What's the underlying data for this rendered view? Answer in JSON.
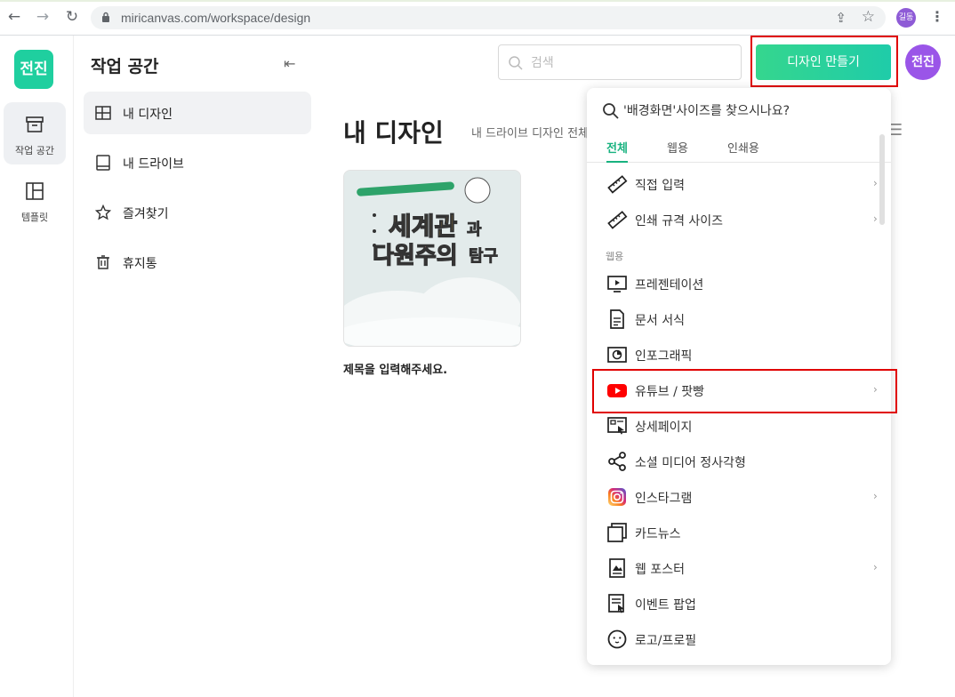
{
  "browser": {
    "url": "miricanvas.com/workspace/design",
    "profile_label": "길동"
  },
  "rail": {
    "logo": "전진",
    "items": [
      {
        "label": "작업 공간",
        "icon": "archive-icon"
      },
      {
        "label": "템플릿",
        "icon": "template-icon"
      }
    ]
  },
  "panel": {
    "title": "작업 공간",
    "nav": [
      {
        "label": "내 디자인",
        "icon": "grid-icon"
      },
      {
        "label": "내 드라이브",
        "icon": "drive-icon"
      },
      {
        "label": "즐겨찾기",
        "icon": "star-icon"
      },
      {
        "label": "휴지통",
        "icon": "trash-icon"
      }
    ]
  },
  "header": {
    "search_placeholder": "검색",
    "create_label": "디자인 만들기",
    "avatar": "전진"
  },
  "main": {
    "title": "내 디자인",
    "subtitle": "내 드라이브 디자인 전체",
    "card": {
      "caption": "제목을 입력해주세요.",
      "art_line1": "세계관",
      "art_line1b": "과",
      "art_line2": "다원주의",
      "art_line2b": "탐구"
    }
  },
  "dropdown": {
    "query": "'배경화면'사이즈를 찾으시나요?",
    "tabs": [
      "전체",
      "웹용",
      "인쇄용"
    ],
    "section_web": "웹용",
    "items": [
      {
        "label": "직접 입력",
        "icon": "ruler-icon",
        "chevron": true
      },
      {
        "label": "인쇄 규격 사이즈",
        "icon": "ruler-icon",
        "chevron": true
      },
      {
        "label": "프레젠테이션",
        "icon": "presentation-icon",
        "chevron": false
      },
      {
        "label": "문서 서식",
        "icon": "document-icon",
        "chevron": false
      },
      {
        "label": "인포그래픽",
        "icon": "infographic-icon",
        "chevron": false
      },
      {
        "label": "유튜브 / 팟빵",
        "icon": "youtube-icon",
        "chevron": true
      },
      {
        "label": "상세페이지",
        "icon": "detail-page-icon",
        "chevron": false
      },
      {
        "label": "소셜 미디어 정사각형",
        "icon": "share-icon",
        "chevron": false
      },
      {
        "label": "인스타그램",
        "icon": "instagram-icon",
        "chevron": true
      },
      {
        "label": "카드뉴스",
        "icon": "cardnews-icon",
        "chevron": false
      },
      {
        "label": "웹 포스터",
        "icon": "poster-icon",
        "chevron": true
      },
      {
        "label": "이벤트 팝업",
        "icon": "popup-icon",
        "chevron": false
      },
      {
        "label": "로고/프로필",
        "icon": "face-icon",
        "chevron": false
      }
    ]
  },
  "colors": {
    "brand": "#1fcf9f",
    "highlight": "#e00000",
    "avatar": "#9a55e8"
  }
}
